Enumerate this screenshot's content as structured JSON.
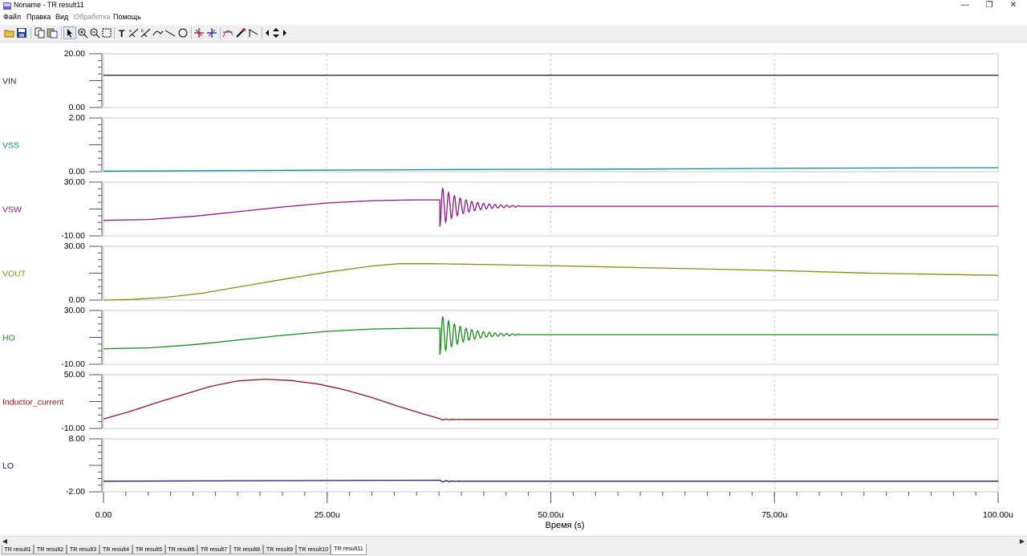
{
  "window": {
    "title": "Noname - TR result11",
    "minimize": "—",
    "maximize": "❐",
    "close": "✕"
  },
  "menu": [
    {
      "label": "Файл",
      "disabled": false
    },
    {
      "label": "Правка",
      "disabled": false
    },
    {
      "label": "Вид",
      "disabled": false
    },
    {
      "label": "Обработка",
      "disabled": true
    },
    {
      "label": "Помощь",
      "disabled": false
    }
  ],
  "toolbar": {
    "buttons": [
      "open-icon",
      "save-icon",
      "copy-icon",
      "paste-icon",
      "pointer-icon",
      "zoom-in-icon",
      "zoom-out-icon",
      "zoom-window-icon",
      "text-tool-icon",
      "cursor-a-icon",
      "cursor-b-icon",
      "cursor-track-icon",
      "line-tool-icon",
      "circle-tool-icon",
      "marker-icon",
      "marker-clear-icon",
      "curve-icon",
      "probe-icon",
      "slope-icon",
      "step-left-icon",
      "step-up-down-icon",
      "step-right-icon"
    ]
  },
  "chart_data": {
    "type": "line",
    "xlabel": "Время (s)",
    "x_ticks": [
      "0.00",
      "25.00u",
      "50.00u",
      "75.00u",
      "100.00u"
    ],
    "x_range_us": [
      0,
      100
    ],
    "grid": "vertical dashed at x ticks",
    "panels": [
      {
        "name": "VIN",
        "color": "#2b2b2b",
        "y_ticks": [
          "20.00",
          "0.00"
        ],
        "ylim": [
          0,
          20
        ],
        "points": [
          [
            0,
            12
          ],
          [
            100,
            12
          ]
        ]
      },
      {
        "name": "VSS",
        "color": "#0d8b9b",
        "y_ticks": [
          "2.00",
          "0.00"
        ],
        "ylim": [
          0,
          2
        ],
        "points": [
          [
            0,
            0.02
          ],
          [
            20,
            0.05
          ],
          [
            40,
            0.08
          ],
          [
            60,
            0.1
          ],
          [
            80,
            0.13
          ],
          [
            100,
            0.15
          ]
        ]
      },
      {
        "name": "VSW",
        "color": "#8b1a8b",
        "y_ticks": [
          "30.00",
          "-10.00"
        ],
        "ylim": [
          -10,
          30
        ],
        "points": [
          [
            0,
            1.5
          ],
          [
            5,
            2.2
          ],
          [
            10,
            4.5
          ],
          [
            15,
            8
          ],
          [
            20,
            11.5
          ],
          [
            25,
            14.5
          ],
          [
            30,
            16.2
          ],
          [
            35,
            16.8
          ],
          [
            37.6,
            16.8
          ],
          [
            37.6,
            -3
          ]
        ],
        "ringing": {
          "start": 37.6,
          "end": 46.5,
          "settle": 12,
          "amp": 15,
          "period": 0.65
        },
        "tail": [
          [
            46.5,
            12
          ],
          [
            100,
            12
          ]
        ]
      },
      {
        "name": "VOUT",
        "color": "#8b8b1a",
        "y_ticks": [
          "30.00",
          "0.00"
        ],
        "ylim": [
          0,
          30
        ],
        "points": [
          [
            0,
            0
          ],
          [
            3,
            0.3
          ],
          [
            7,
            1.5
          ],
          [
            11,
            3.8
          ],
          [
            15,
            7.2
          ],
          [
            20,
            11.5
          ],
          [
            25,
            15.6
          ],
          [
            30,
            19
          ],
          [
            33,
            20.3
          ],
          [
            37,
            20.3
          ],
          [
            50,
            19.2
          ],
          [
            60,
            18.1
          ],
          [
            75,
            16.5
          ],
          [
            85,
            15.1
          ],
          [
            100,
            13.8
          ]
        ]
      },
      {
        "name": "HO",
        "color": "#1a8b1a",
        "y_ticks": [
          "30.00",
          "-10.00"
        ],
        "ylim": [
          -10,
          30
        ],
        "points": [
          [
            0,
            1.5
          ],
          [
            5,
            2.2
          ],
          [
            10,
            4.5
          ],
          [
            15,
            8
          ],
          [
            20,
            11.5
          ],
          [
            25,
            14.5
          ],
          [
            30,
            16.2
          ],
          [
            35,
            16.8
          ],
          [
            37.6,
            16.8
          ],
          [
            37.6,
            -3
          ]
        ],
        "ringing": {
          "start": 37.6,
          "end": 46.5,
          "settle": 12,
          "amp": 15,
          "period": 0.65
        },
        "tail": [
          [
            46.5,
            12
          ],
          [
            100,
            12
          ]
        ]
      },
      {
        "name": "Inductor_current",
        "color": "#8b1a1a",
        "y_ticks": [
          "50.00",
          "-10.00"
        ],
        "ylim": [
          -10,
          50
        ],
        "points": [
          [
            0,
            0.5
          ],
          [
            3,
            9
          ],
          [
            6,
            19
          ],
          [
            9,
            28
          ],
          [
            12,
            37
          ],
          [
            15,
            43
          ],
          [
            18,
            45
          ],
          [
            21,
            43.5
          ],
          [
            24,
            39.5
          ],
          [
            27,
            33
          ],
          [
            30,
            24.5
          ],
          [
            33,
            14.5
          ],
          [
            36,
            5.5
          ],
          [
            37.6,
            0
          ],
          [
            100,
            0
          ]
        ],
        "ringing": {
          "start": 37.6,
          "end": 41,
          "settle": 0,
          "amp": 0.8,
          "period": 0.7
        }
      },
      {
        "name": "LO",
        "color": "#1a1a6b",
        "y_ticks": [
          "8.00",
          "-2.00"
        ],
        "ylim": [
          -2,
          8
        ],
        "points": [
          [
            0,
            0
          ],
          [
            100,
            0
          ]
        ],
        "ringing": {
          "start": 37.6,
          "end": 40.5,
          "settle": 0,
          "amp": 0.2,
          "period": 0.7
        }
      }
    ]
  },
  "tabs": [
    "TR result1",
    "TR result2",
    "TR result3",
    "TR result4",
    "TR result5",
    "TR result6",
    "TR result7",
    "TR result8",
    "TR result9",
    "TR result10",
    "TR result11"
  ],
  "active_tab": "TR result11"
}
